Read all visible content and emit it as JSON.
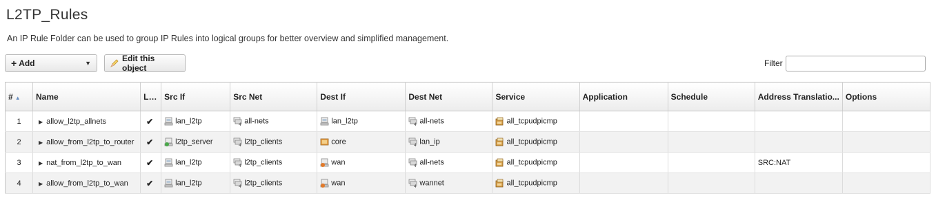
{
  "page": {
    "title": "L2TP_Rules",
    "description": "An IP Rule Folder can be used to group IP Rules into logical groups for better overview and simplified management."
  },
  "toolbar": {
    "add_label": "Add",
    "edit_label": "Edit this object",
    "filter_label": "Filter",
    "filter_value": ""
  },
  "columns": [
    "#",
    "Name",
    "Log",
    "Src If",
    "Src Net",
    "Dest If",
    "Dest Net",
    "Service",
    "Application",
    "Schedule",
    "Address Translatio...",
    "Options"
  ],
  "rows": [
    {
      "num": "1",
      "name": "allow_l2tp_allnets",
      "log": "✔",
      "src_if": "lan_l2tp",
      "src_net": "all-nets",
      "dest_if": "lan_l2tp",
      "dest_net": "all-nets",
      "service": "all_tcpudpicmp",
      "application": "",
      "schedule": "",
      "address_translation": "",
      "options": ""
    },
    {
      "num": "2",
      "name": "allow_from_l2tp_to_router",
      "log": "✔",
      "src_if": "l2tp_server",
      "src_net": "l2tp_clients",
      "dest_if": "core",
      "dest_net": "lan_ip",
      "service": "all_tcpudpicmp",
      "application": "",
      "schedule": "",
      "address_translation": "",
      "options": ""
    },
    {
      "num": "3",
      "name": "nat_from_l2tp_to_wan",
      "log": "✔",
      "src_if": "lan_l2tp",
      "src_net": "l2tp_clients",
      "dest_if": "wan",
      "dest_net": "all-nets",
      "service": "all_tcpudpicmp",
      "application": "",
      "schedule": "",
      "address_translation": "SRC:NAT",
      "options": ""
    },
    {
      "num": "4",
      "name": "allow_from_l2tp_to_wan",
      "log": "✔",
      "src_if": "lan_l2tp",
      "src_net": "l2tp_clients",
      "dest_if": "wan",
      "dest_net": "wannet",
      "service": "all_tcpudpicmp",
      "application": "",
      "schedule": "",
      "address_translation": "",
      "options": ""
    }
  ],
  "icons": {
    "src_if": [
      "interface-icon",
      "l2tp-server-icon",
      "interface-icon",
      "interface-icon"
    ],
    "dest_if": [
      "interface-icon",
      "core-icon",
      "wan-icon",
      "wan-icon"
    ]
  }
}
